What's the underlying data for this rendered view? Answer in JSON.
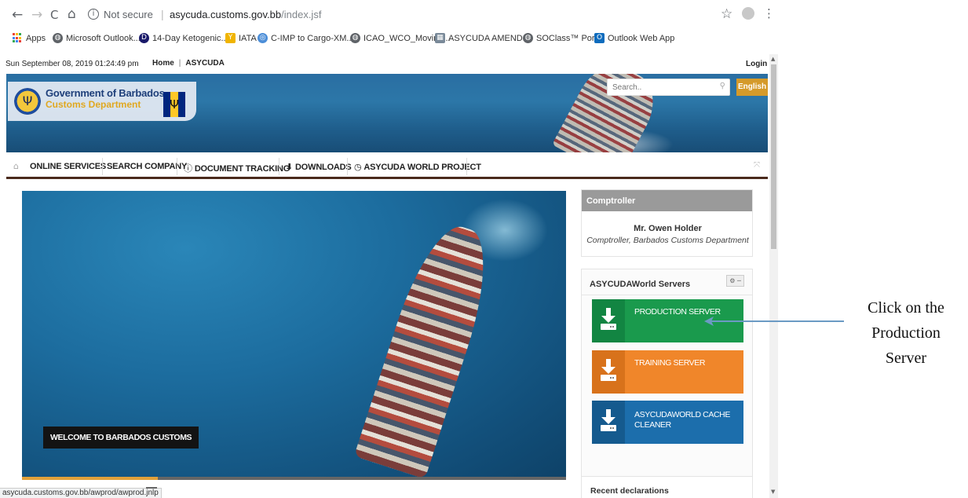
{
  "browser": {
    "nav": {
      "back": "←",
      "forward": "→",
      "reload": "C",
      "home": "⌂"
    },
    "security_label": "Not secure",
    "url_host": "asycuda.customs.gov.bb",
    "url_path": "/index.jsf",
    "star": "☆",
    "menu": "⋮",
    "bookmarks": [
      {
        "label": "Apps",
        "icon": "apps-icon"
      },
      {
        "label": "Microsoft Outlook...",
        "icon": "globe-icon"
      },
      {
        "label": "14-Day Ketogenic...",
        "icon": "d-icon"
      },
      {
        "label": "IATA",
        "icon": "iata-icon"
      },
      {
        "label": "C-IMP to Cargo-XM...",
        "icon": "un-icon"
      },
      {
        "label": "ICAO_WCO_Moving...",
        "icon": "globe-icon"
      },
      {
        "label": "ASYCUDA AMEND...",
        "icon": "asycuda-icon"
      },
      {
        "label": "SOClass™ Portal",
        "icon": "globe-icon"
      },
      {
        "label": "Outlook Web App",
        "icon": "outlook-icon"
      }
    ],
    "status_url": "asycuda.customs.gov.bb/awprod/awprod.jnlp"
  },
  "site": {
    "datetime": "Sun September 08, 2019 01:24:49 pm",
    "top_links": [
      "Home",
      "ASYCUDA"
    ],
    "login": "Login",
    "logo": {
      "line1": "Government of Barbados",
      "line2": "Customs Department"
    },
    "search_placeholder": "Search..",
    "language": "English",
    "nav": [
      {
        "label": "ONLINE SERVICES",
        "icon": ""
      },
      {
        "label": "SEARCH COMPANY",
        "icon": ""
      },
      {
        "label": "DOCUMENT TRACKING",
        "icon": "ⓘ"
      },
      {
        "label": "DOWNLOADS",
        "icon": "⬇"
      },
      {
        "label": "ASYCUDA WORLD PROJECT",
        "icon": "◷"
      }
    ],
    "hero_caption": "WELCOME TO BARBADOS CUSTOMS",
    "slider_progress": 0.25,
    "comptroller": {
      "header": "Comptroller",
      "name": "Mr. Owen Holder",
      "role": "Comptroller, Barbados Customs Department"
    },
    "servers": {
      "title": "ASYCUDAWorld Servers",
      "items": [
        {
          "label": "PRODUCTION SERVER",
          "color": "#1a9a4d",
          "icon_bg": "#128542"
        },
        {
          "label": "TRAINING SERVER",
          "color": "#f0862a",
          "icon_bg": "#d8721b"
        },
        {
          "label": "ASYCUDAWORLD CACHE CLEANER",
          "color": "#1c6eac",
          "icon_bg": "#155a8e"
        }
      ]
    },
    "recent_title": "Recent declarations"
  },
  "annotation": {
    "line1": "Click on the",
    "line2": "Production",
    "line3": "Server",
    "arrow_color": "#6b9ac4"
  }
}
